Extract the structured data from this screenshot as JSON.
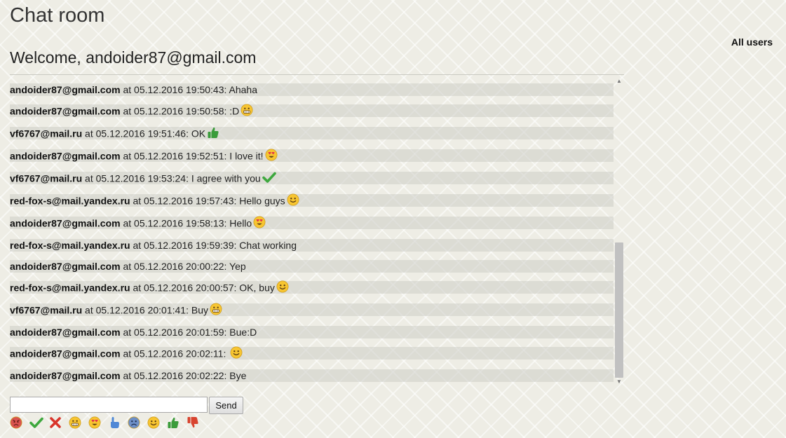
{
  "header": {
    "title": "Chat room",
    "welcome": "Welcome, andoider87@gmail.com"
  },
  "sidebar": {
    "all_users_label": "All users"
  },
  "messages": [
    {
      "author": "andoider87@gmail.com",
      "meta": " at 05.12.2016 19:50:43: ",
      "text": "Ahaha",
      "emoji": ""
    },
    {
      "author": "andoider87@gmail.com",
      "meta": " at 05.12.2016 19:50:58: ",
      "text": ":D",
      "emoji": "grin"
    },
    {
      "author": "vf6767@mail.ru",
      "meta": " at 05.12.2016 19:51:46: ",
      "text": "OK",
      "emoji": "thumbs-up"
    },
    {
      "author": "andoider87@gmail.com",
      "meta": " at 05.12.2016 19:52:51: ",
      "text": "I love it!",
      "emoji": "heart-eyes"
    },
    {
      "author": "vf6767@mail.ru",
      "meta": " at 05.12.2016 19:53:24: ",
      "text": "I agree with you",
      "emoji": "check"
    },
    {
      "author": "red-fox-s@mail.yandex.ru",
      "meta": " at 05.12.2016 19:57:43: ",
      "text": "Hello guys",
      "emoji": "smile"
    },
    {
      "author": "andoider87@gmail.com",
      "meta": " at 05.12.2016 19:58:13: ",
      "text": "Hello",
      "emoji": "heart-eyes"
    },
    {
      "author": "red-fox-s@mail.yandex.ru",
      "meta": " at 05.12.2016 19:59:39: ",
      "text": "Chat working",
      "emoji": ""
    },
    {
      "author": "andoider87@gmail.com",
      "meta": " at 05.12.2016 20:00:22: ",
      "text": "Yep",
      "emoji": ""
    },
    {
      "author": "red-fox-s@mail.yandex.ru",
      "meta": " at 05.12.2016 20:00:57: ",
      "text": "OK, buy",
      "emoji": "smile"
    },
    {
      "author": "vf6767@mail.ru",
      "meta": " at 05.12.2016 20:01:41: ",
      "text": "Buy",
      "emoji": "grin"
    },
    {
      "author": "andoider87@gmail.com",
      "meta": " at 05.12.2016 20:01:59: ",
      "text": "Bue:D",
      "emoji": ""
    },
    {
      "author": "andoider87@gmail.com",
      "meta": " at 05.12.2016 20:02:11: ",
      "text": " ",
      "emoji": "smile"
    },
    {
      "author": "andoider87@gmail.com",
      "meta": " at 05.12.2016 20:02:22: ",
      "text": "Bye",
      "emoji": ""
    }
  ],
  "composer": {
    "input_value": "",
    "send_label": "Send"
  },
  "emoji_palette": [
    "angry",
    "check",
    "cross",
    "grin",
    "heart-eyes",
    "pointing-hand",
    "sad",
    "smile",
    "thumbs-up",
    "thumbs-down"
  ],
  "colors": {
    "smiley_yellow": "#f7c531",
    "angry_red": "#d9534f",
    "check_green": "#3ea83e",
    "cross_red": "#d9342b",
    "heart_red": "#e2334a",
    "hand_blue": "#4f88d6",
    "sad_blue": "#6d8fc7",
    "thumb_green": "#3b9c3b",
    "thumb_red": "#d8432f"
  }
}
